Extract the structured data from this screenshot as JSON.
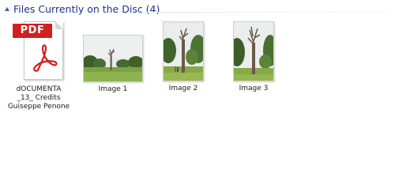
{
  "group": {
    "title": "Files Currently on the Disc (4)"
  },
  "files": [
    {
      "name": "dOCUMENTA_13_ Credits Guiseppe Penone",
      "label_lines": [
        "dOCUMENTA",
        "_13_ Credits",
        "Guiseppe Penone"
      ],
      "type": "pdf",
      "icon_text": "PDF"
    },
    {
      "name": "Image 1",
      "type": "image"
    },
    {
      "name": "Image 2",
      "type": "image"
    },
    {
      "name": "Image 3",
      "type": "image"
    }
  ],
  "colors": {
    "group_title": "#1e3287",
    "pdf_red": "#d21f1f"
  }
}
